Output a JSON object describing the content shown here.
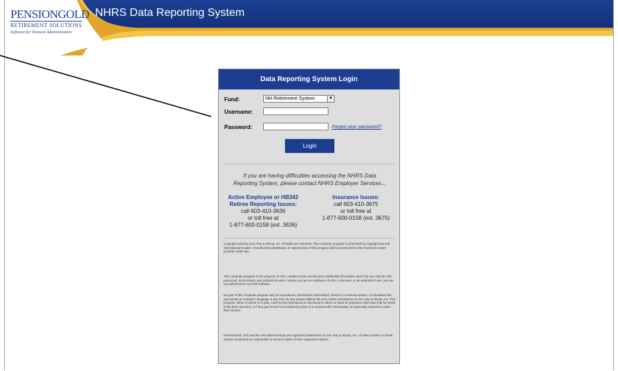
{
  "header": {
    "title": "NHRS Data Reporting System",
    "logo_main": "PENSIONGOLD",
    "logo_sub": "RETIREMENT SOLUTIONS",
    "logo_tag": "Software for Pension Administration"
  },
  "login": {
    "title": "Data Reporting System Login",
    "fund_label": "Fund:",
    "fund_value": "NH Retirement System",
    "username_label": "Username:",
    "username_value": "",
    "password_label": "Password:",
    "password_value": "",
    "forgot_link": "Forgot your password?",
    "login_button": "Login"
  },
  "help": {
    "difficulty_text": "If you are having difficulties accessing the NHRS Data Reporting System, please contact NHRS Employer Services...",
    "active": {
      "head1": "Active Employee or HB342",
      "head2": "Retiree Reporting Issues:",
      "line1": "call 603-410-3636",
      "line2": "or toll free at",
      "line3": "1-877-600-0158 (ext. 3636)"
    },
    "insurance": {
      "head1": "Insurance Issues:",
      "line1": "call 603-410-3675",
      "line2": "or toll free at",
      "line3": "1-877-600-0158 (ext. 3675)"
    }
  },
  "legal": {
    "p1": "Copyright 2019 by Levi, Ray & Shoup, Inc. All rights are reserved. This computer program is protected by copyright law and international treaties. Unauthorized distribution or reproduction of this program will be prosecuted to the maximum extent possible under law.",
    "p2": "This computer program is the property of LRS, contains trade secrets and confidential information and is for use only by LRS personnel, its licensees, and authorized users. Unless you are an employee of LRS, a licensee, or an authorized user, you are not authorized to use this software.",
    "p3": "No part of this computer program may be reproduced, transmitted, transcribed, stored in a retrieval system, or translated into any human or computer language in any form by any means without the prior written permission of Levi, Ray & Shoup, Inc. This program, either in whole or in part, must not be reproduced or disclosed to others or used for purposes other than that for which it has been licensed, or if any part hereof is furnished by virtue of a contract with a third party, as expressly authorized under that contract.",
    "p4": "PensionGold, LRS and the LRS diamond logo are registered trademarks of Levi, Ray & Shoup, Inc. All other product or brand names mentioned are trademarks or service marks of their respective holders."
  },
  "colors": {
    "brand_blue": "#1b3e91",
    "gold": "#e9b636"
  }
}
